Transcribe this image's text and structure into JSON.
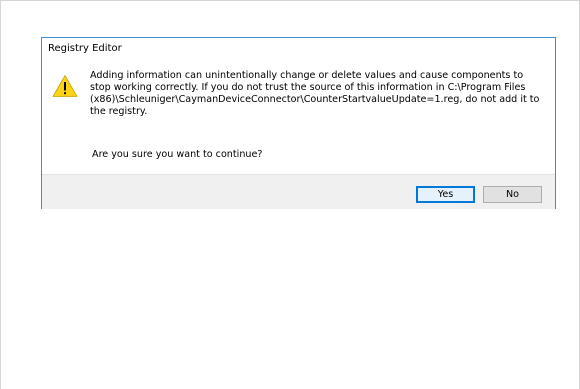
{
  "dialog": {
    "title": "Registry Editor",
    "icon": "warning-icon",
    "message_lines": [
      "Adding information can unintentionally change or delete values and cause components to",
      "stop working correctly. If you do not trust the source of this information in C:\\Program Files",
      "(x86)\\Schleuniger\\CaymanDeviceConnector\\CounterStartvalueUpdate=1.reg, do not add it to",
      "the registry."
    ],
    "question": "Are you sure you want to continue?",
    "buttons": {
      "yes_label": "Yes",
      "no_label": "No"
    }
  },
  "colors": {
    "dialog_border": "#3c8fd6",
    "button_bar": "#f0f0f0",
    "default_button_border": "#0078d7",
    "warning_yellow": "#fcd116"
  }
}
